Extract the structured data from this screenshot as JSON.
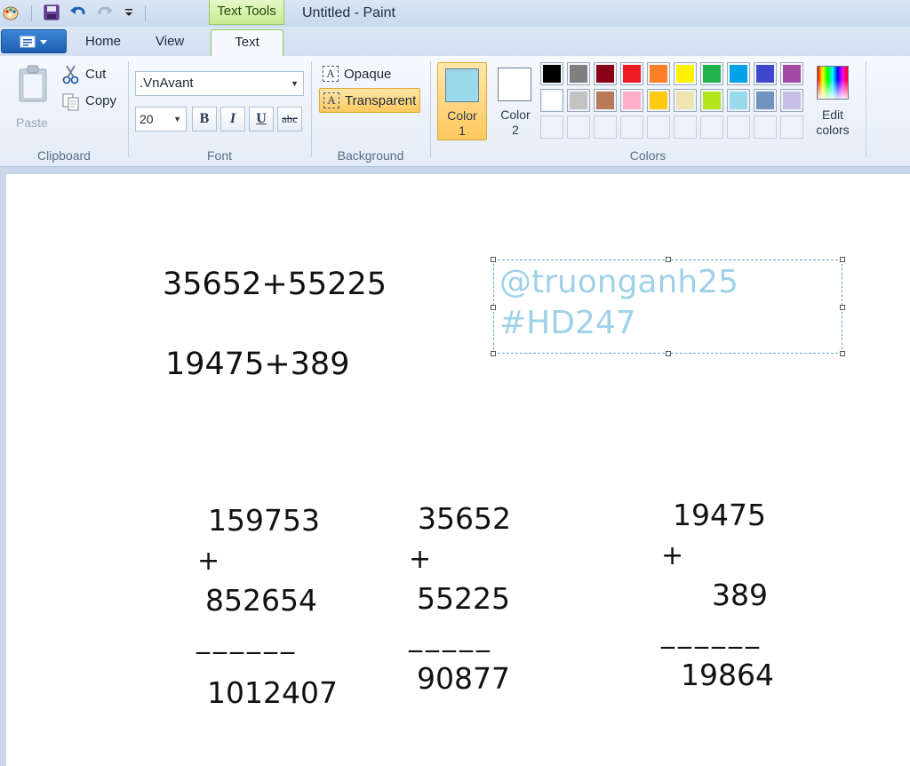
{
  "window": {
    "title": "Untitled - Paint",
    "context_tab": "Text Tools"
  },
  "tabs": {
    "home": "Home",
    "view": "View",
    "text": "Text"
  },
  "clipboard": {
    "paste": "Paste",
    "cut": "Cut",
    "copy": "Copy",
    "label": "Clipboard"
  },
  "font": {
    "family": ".VnAvant",
    "size": "20",
    "bold": "B",
    "italic": "I",
    "underline": "U",
    "strike": "abc",
    "label": "Font"
  },
  "background": {
    "opaque": "Opaque",
    "transparent": "Transparent",
    "label": "Background",
    "icon_letter": "A"
  },
  "colors": {
    "label": "Colors",
    "color1_label": "Color\n1",
    "color2_label": "Color\n2",
    "color1": "#99d9ea",
    "color2": "#ffffff",
    "edit_label": "Edit colors",
    "palette_row1": [
      "#000000",
      "#7f7f7f",
      "#880015",
      "#ed1c24",
      "#ff7f27",
      "#fff200",
      "#22b14c",
      "#00a2e8",
      "#3f48cc",
      "#a349a4"
    ],
    "palette_row2": [
      "#ffffff",
      "#c3c3c3",
      "#b97a57",
      "#ffaec9",
      "#ffc90e",
      "#efe4b0",
      "#b5e61d",
      "#99d9ea",
      "#7092be",
      "#c8bfe7"
    ]
  },
  "canvas": {
    "expr1": "35652+55225",
    "expr2": "19475+389",
    "textbox_line1": "@truonganh25",
    "textbox_line2": "#HD247",
    "calc1": {
      "a": "159753",
      "op": "+",
      "b": "852654",
      "line": "______",
      "result": "1012407"
    },
    "calc2": {
      "a": "35652",
      "op": "+",
      "b": "55225",
      "line": "_____",
      "result": "90877"
    },
    "calc3": {
      "a": "19475",
      "op": "+",
      "b": "389",
      "line": "______",
      "result": "19864"
    }
  }
}
